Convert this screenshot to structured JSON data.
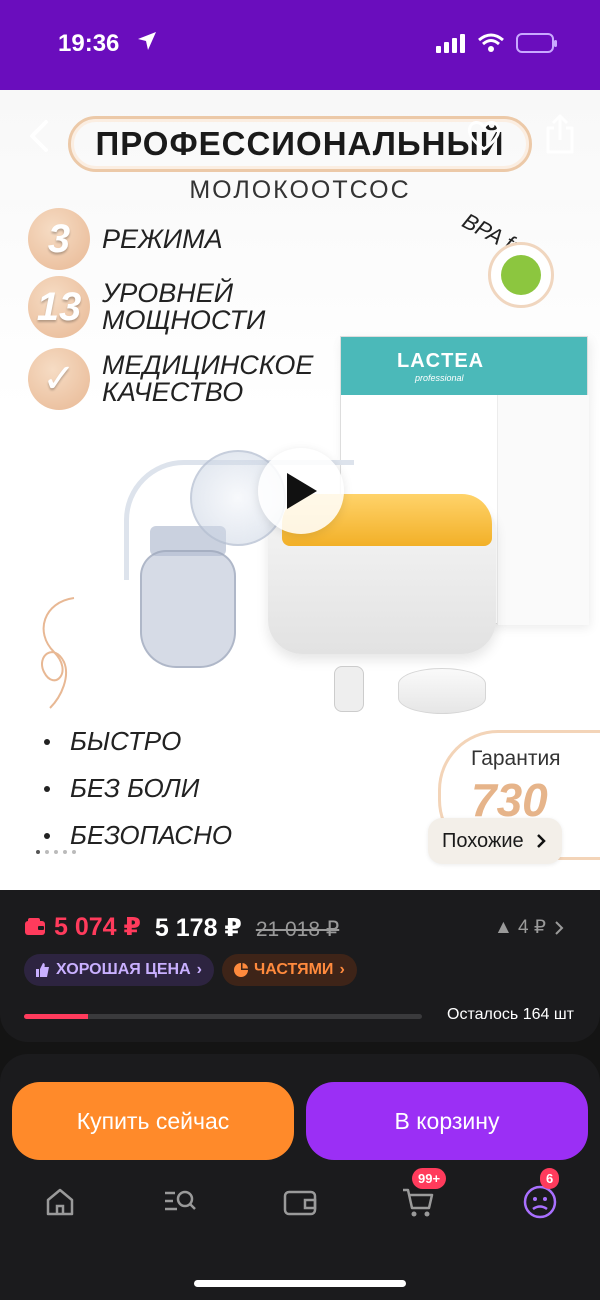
{
  "status_bar": {
    "time": "19:36"
  },
  "product": {
    "headline": "ПРОФЕССИОНАЛЬНЫЙ",
    "subheadline": "МОЛОКООТСОС",
    "features": [
      {
        "badge": "3",
        "text": "РЕЖИМА"
      },
      {
        "badge": "13",
        "text": "УРОВНЕЙ МОЩНОСТИ"
      },
      {
        "badge": "✓",
        "text": "МЕДИЦИНСКОЕ КАЧЕСТВО"
      }
    ],
    "bpa_label": "BPA free",
    "box_brand": "LACTEA",
    "box_sub": "professional",
    "bullets": [
      "БЫСТРО",
      "БЕЗ БОЛИ",
      "БЕЗОПАСНО"
    ],
    "warranty_label": "Гарантия",
    "warranty_value": "730",
    "similar_label": "Похожие",
    "gallery_count": 5,
    "gallery_active": 0
  },
  "price": {
    "wallet_price": "5 074 ₽",
    "card_price": "5 178 ₽",
    "old_price": "21 018 ₽",
    "price_change": "▲ 4 ₽",
    "tags": [
      {
        "label": "ХОРОШАЯ ЦЕНА",
        "icon": "thumb-up-icon"
      },
      {
        "label": "ЧАСТЯМИ",
        "icon": "pie-chart-icon"
      }
    ],
    "stock_text": "Осталось 164 шт",
    "stock_fraction": 0.16
  },
  "actions": {
    "buy_now": "Купить сейчас",
    "to_cart": "В корзину"
  },
  "tabbar": {
    "cart_badge": "99+",
    "profile_badge": "6"
  },
  "colors": {
    "status_bar": "#6a0dbd",
    "wallet_price": "#ff3b5c",
    "buy_now": "#ff8a2a",
    "to_cart": "#9b2ff5"
  }
}
